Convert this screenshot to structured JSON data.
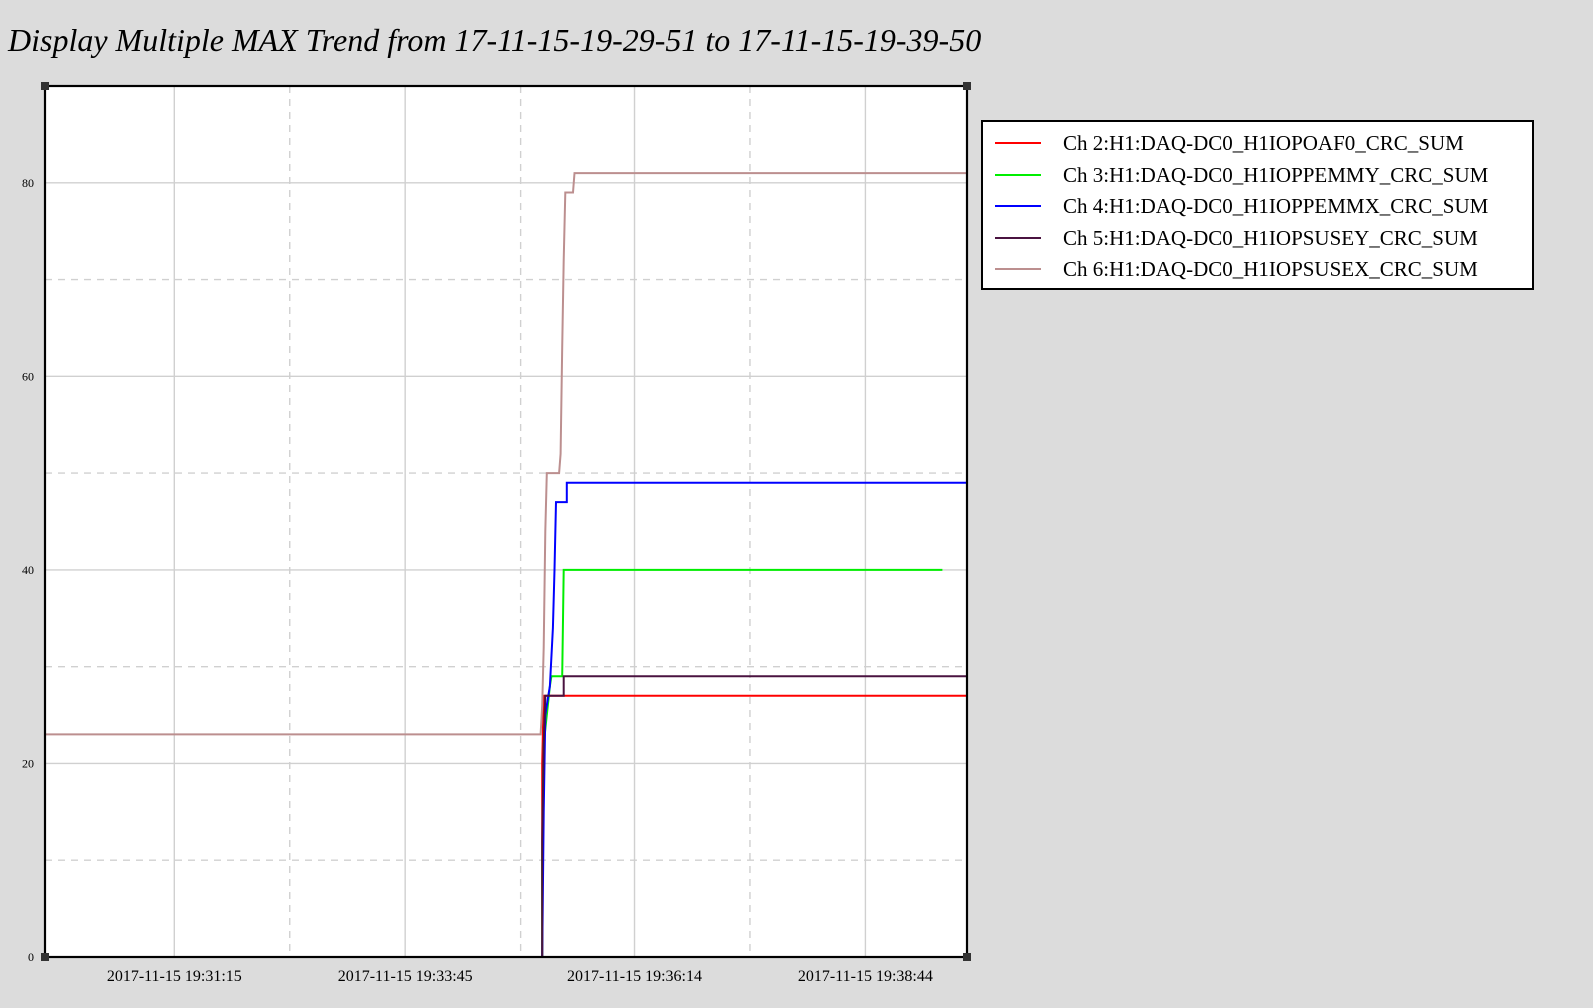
{
  "title": "Display Multiple MAX Trend from 17-11-15-19-29-51 to 17-11-15-19-39-50",
  "chart_data": {
    "type": "line",
    "title": "Display Multiple MAX Trend from 17-11-15-19-29-51 to 17-11-15-19-39-50",
    "xlabel": "",
    "ylabel": "",
    "x_unit": "seconds since 19:29:51",
    "xlim": [
      0,
      599
    ],
    "ylim": [
      0,
      90
    ],
    "yticks": [
      0,
      20,
      40,
      60,
      80
    ],
    "xticks": [
      {
        "value": 84,
        "label": "2017-11-15 19:31:15"
      },
      {
        "value": 234,
        "label": "2017-11-15 19:33:45"
      },
      {
        "value": 383,
        "label": "2017-11-15 19:36:14"
      },
      {
        "value": 533,
        "label": "2017-11-15 19:38:44"
      }
    ],
    "legend_position": "right",
    "series": [
      {
        "name": "Ch 2:H1:DAQ-DC0_H1IOPOAF0_CRC_SUM",
        "color": "#ff0000",
        "points": [
          [
            323,
            0
          ],
          [
            323,
            20
          ],
          [
            324,
            27
          ],
          [
            599,
            27
          ]
        ]
      },
      {
        "name": "Ch 3:H1:DAQ-DC0_H1IOPPEMMY_CRC_SUM",
        "color": "#00ee00",
        "points": [
          [
            323,
            0
          ],
          [
            323,
            10
          ],
          [
            324,
            22
          ],
          [
            328,
            28
          ],
          [
            329,
            29
          ],
          [
            336,
            29
          ],
          [
            337,
            40
          ],
          [
            583,
            40
          ]
        ]
      },
      {
        "name": "Ch 4:H1:DAQ-DC0_H1IOPPEMMX_CRC_SUM",
        "color": "#0000ff",
        "points": [
          [
            323,
            0
          ],
          [
            324,
            15
          ],
          [
            325,
            25
          ],
          [
            327,
            27
          ],
          [
            328,
            28
          ],
          [
            330,
            34
          ],
          [
            331,
            40
          ],
          [
            332,
            47
          ],
          [
            339,
            47
          ],
          [
            339,
            49
          ],
          [
            599,
            49
          ]
        ]
      },
      {
        "name": "Ch 5:H1:DAQ-DC0_H1IOPSUSEY_CRC_SUM",
        "color": "#4a1340",
        "points": [
          [
            323,
            0
          ],
          [
            323,
            12
          ],
          [
            324,
            22
          ],
          [
            325,
            27
          ],
          [
            337,
            27
          ],
          [
            337,
            29
          ],
          [
            599,
            29
          ]
        ]
      },
      {
        "name": "Ch 6:H1:DAQ-DC0_H1IOPSUSEX_CRC_SUM",
        "color": "#bc8f8f",
        "points": [
          [
            0,
            23
          ],
          [
            322,
            23
          ],
          [
            323,
            26
          ],
          [
            324,
            32
          ],
          [
            325,
            44
          ],
          [
            326,
            50
          ],
          [
            334,
            50
          ],
          [
            335,
            52
          ],
          [
            336,
            63
          ],
          [
            337,
            72
          ],
          [
            338,
            79
          ],
          [
            343,
            79
          ],
          [
            344,
            81
          ],
          [
            599,
            81
          ]
        ]
      }
    ],
    "grid": true
  }
}
